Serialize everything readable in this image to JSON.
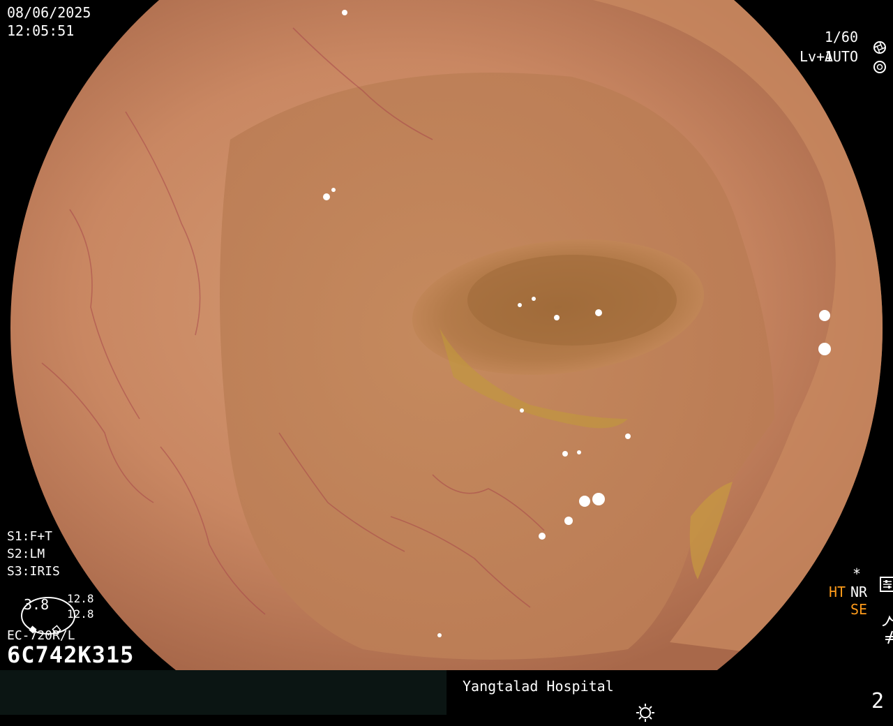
{
  "overlay": {
    "date": "08/06/2025",
    "time": "12:05:51",
    "shutter": "1/60",
    "level": "Lv+1",
    "iris_mode": "AUTO",
    "s1": "S1:F+T",
    "s2": "S2:LM",
    "s3": "S3:IRIS",
    "zoom_value": "3.8",
    "reading_1": "12.8",
    "reading_2": "12.8",
    "scope_model": "EC-720R/L",
    "scope_serial": "6C742K315",
    "asterisk": "*",
    "ht_label": "HT",
    "nr_label": "NR",
    "se_label": "SE",
    "hospital": "Yangtalad Hospital",
    "page_number": "2"
  },
  "colors": {
    "accent_orange": "#ff9b1a",
    "bar_dark": "#0b1513",
    "mucosa": "#c98a62"
  },
  "icons": [
    "shutter-icon",
    "iris-icon",
    "settings-icon",
    "se-curve-icon",
    "flash-off-icon",
    "brightness-icon"
  ]
}
